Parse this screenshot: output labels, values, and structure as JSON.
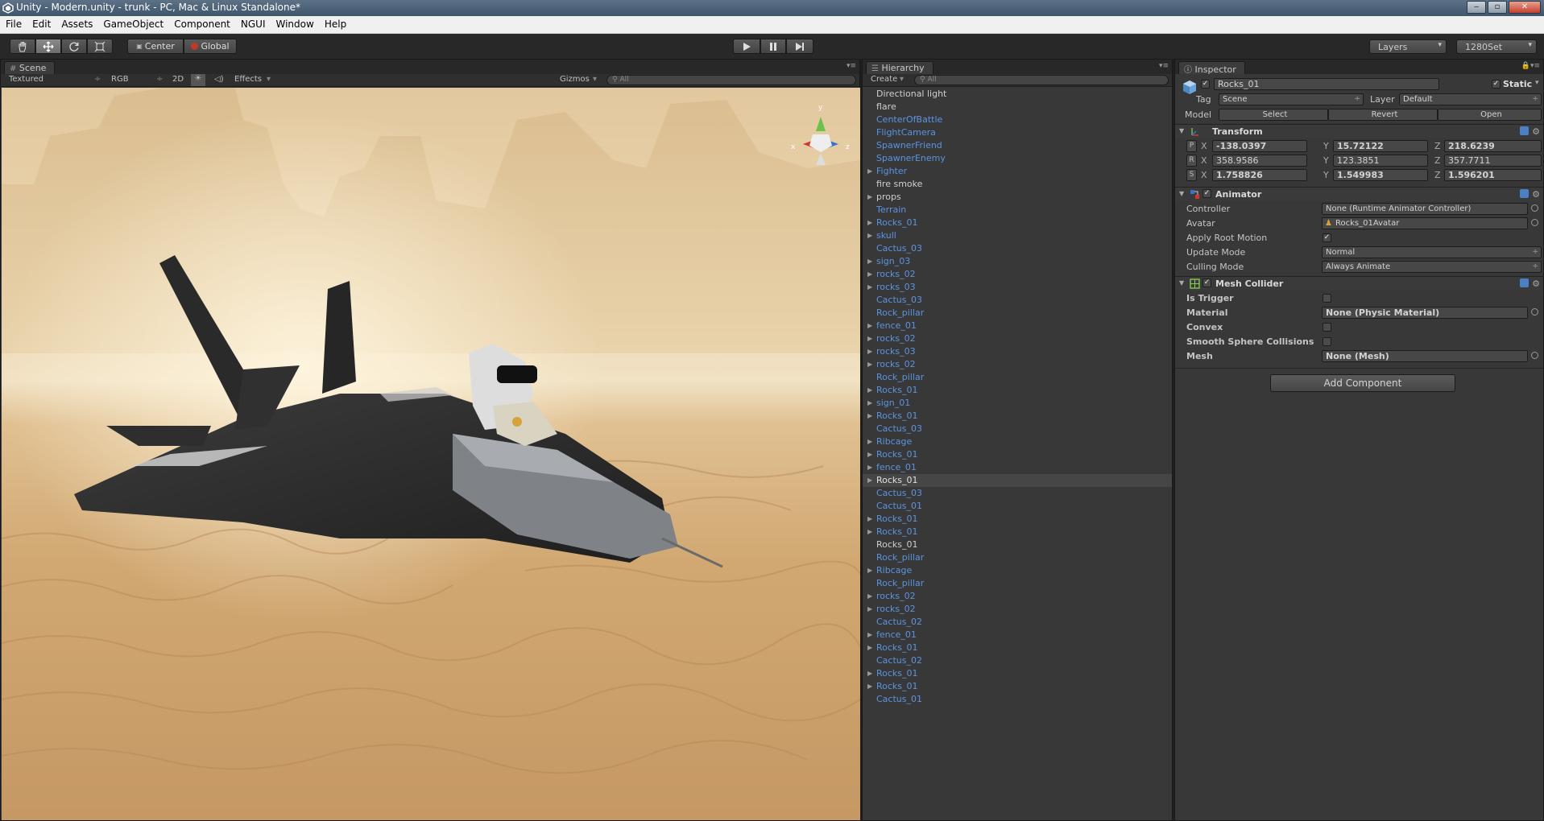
{
  "window": {
    "title": "Unity - Modern.unity - trunk - PC, Mac & Linux Standalone*"
  },
  "menu": [
    "File",
    "Edit",
    "Assets",
    "GameObject",
    "Component",
    "NGUI",
    "Window",
    "Help"
  ],
  "toolbar": {
    "pivot": "Center",
    "space": "Global",
    "layers": "Layers",
    "layout": "1280Set"
  },
  "scene": {
    "tab": "Scene",
    "shading": "Textured",
    "render": "RGB",
    "mode2d": "2D",
    "effects": "Effects",
    "gizmos": "Gizmos",
    "search_placeholder": "All",
    "gizmo_labels": {
      "y": "y",
      "x": "x",
      "z": "z"
    }
  },
  "hierarchy": {
    "tab": "Hierarchy",
    "create": "Create",
    "search_placeholder": "All",
    "items": [
      {
        "name": "Directional light",
        "arrow": false,
        "plain": true
      },
      {
        "name": "flare",
        "arrow": false,
        "plain": true
      },
      {
        "name": "CenterOfBattle",
        "arrow": false,
        "plain": false
      },
      {
        "name": "FlightCamera",
        "arrow": false,
        "plain": false
      },
      {
        "name": "SpawnerFriend",
        "arrow": false,
        "plain": false
      },
      {
        "name": "SpawnerEnemy",
        "arrow": false,
        "plain": false
      },
      {
        "name": "Fighter",
        "arrow": true,
        "plain": false
      },
      {
        "name": "fire smoke",
        "arrow": false,
        "plain": true
      },
      {
        "name": "props",
        "arrow": true,
        "plain": true
      },
      {
        "name": "Terrain",
        "arrow": false,
        "plain": false
      },
      {
        "name": "Rocks_01",
        "arrow": true,
        "plain": false
      },
      {
        "name": "skull",
        "arrow": true,
        "plain": false
      },
      {
        "name": "Cactus_03",
        "arrow": false,
        "plain": false
      },
      {
        "name": "sign_03",
        "arrow": true,
        "plain": false
      },
      {
        "name": "rocks_02",
        "arrow": true,
        "plain": false
      },
      {
        "name": "rocks_03",
        "arrow": true,
        "plain": false
      },
      {
        "name": "Cactus_03",
        "arrow": false,
        "plain": false
      },
      {
        "name": "Rock_pillar",
        "arrow": false,
        "plain": false
      },
      {
        "name": "fence_01",
        "arrow": true,
        "plain": false
      },
      {
        "name": "rocks_02",
        "arrow": true,
        "plain": false
      },
      {
        "name": "rocks_03",
        "arrow": true,
        "plain": false
      },
      {
        "name": "rocks_02",
        "arrow": true,
        "plain": false
      },
      {
        "name": "Rock_pillar",
        "arrow": false,
        "plain": false
      },
      {
        "name": "Rocks_01",
        "arrow": true,
        "plain": false
      },
      {
        "name": "sign_01",
        "arrow": true,
        "plain": false
      },
      {
        "name": "Rocks_01",
        "arrow": true,
        "plain": false
      },
      {
        "name": "Cactus_03",
        "arrow": false,
        "plain": false
      },
      {
        "name": "Ribcage",
        "arrow": true,
        "plain": false
      },
      {
        "name": "Rocks_01",
        "arrow": true,
        "plain": false
      },
      {
        "name": "fence_01",
        "arrow": true,
        "plain": false
      },
      {
        "name": "Rocks_01",
        "arrow": true,
        "plain": true,
        "selected": true
      },
      {
        "name": "Cactus_03",
        "arrow": false,
        "plain": false
      },
      {
        "name": "Cactus_01",
        "arrow": false,
        "plain": false
      },
      {
        "name": "Rocks_01",
        "arrow": true,
        "plain": false
      },
      {
        "name": "Rocks_01",
        "arrow": true,
        "plain": false
      },
      {
        "name": "Rocks_01",
        "arrow": false,
        "plain": true
      },
      {
        "name": "Rock_pillar",
        "arrow": false,
        "plain": false
      },
      {
        "name": "Ribcage",
        "arrow": true,
        "plain": false
      },
      {
        "name": "Rock_pillar",
        "arrow": false,
        "plain": false
      },
      {
        "name": "rocks_02",
        "arrow": true,
        "plain": false
      },
      {
        "name": "rocks_02",
        "arrow": true,
        "plain": false
      },
      {
        "name": "Cactus_02",
        "arrow": false,
        "plain": false
      },
      {
        "name": "fence_01",
        "arrow": true,
        "plain": false
      },
      {
        "name": "Rocks_01",
        "arrow": true,
        "plain": false
      },
      {
        "name": "Cactus_02",
        "arrow": false,
        "plain": false
      },
      {
        "name": "Rocks_01",
        "arrow": true,
        "plain": false
      },
      {
        "name": "Rocks_01",
        "arrow": true,
        "plain": false
      },
      {
        "name": "Cactus_01",
        "arrow": false,
        "plain": false
      }
    ]
  },
  "inspector": {
    "tab": "Inspector",
    "object_name": "Rocks_01",
    "static_label": "Static",
    "tag_label": "Tag",
    "tag_value": "Scene",
    "layer_label": "Layer",
    "layer_value": "Default",
    "model_label": "Model",
    "model_select": "Select",
    "model_revert": "Revert",
    "model_open": "Open",
    "transform": {
      "title": "Transform",
      "rows": [
        {
          "key": "P",
          "x": "-138.0397",
          "y": "15.72122",
          "z": "218.6239"
        },
        {
          "key": "R",
          "x": "358.9586",
          "y": "123.3851",
          "z": "357.7711"
        },
        {
          "key": "S",
          "x": "1.758826",
          "y": "1.549983",
          "z": "1.596201"
        }
      ],
      "axis_x": "X",
      "axis_y": "Y",
      "axis_z": "Z"
    },
    "animator": {
      "title": "Animator",
      "controller_label": "Controller",
      "controller_value": "None (Runtime Animator Controller)",
      "avatar_label": "Avatar",
      "avatar_value": "Rocks_01Avatar",
      "apply_root_label": "Apply Root Motion",
      "update_mode_label": "Update Mode",
      "update_mode_value": "Normal",
      "culling_mode_label": "Culling Mode",
      "culling_mode_value": "Always Animate"
    },
    "mesh_collider": {
      "title": "Mesh Collider",
      "is_trigger_label": "Is Trigger",
      "material_label": "Material",
      "material_value": "None (Physic Material)",
      "convex_label": "Convex",
      "smooth_label": "Smooth Sphere Collisions",
      "mesh_label": "Mesh",
      "mesh_value": "None (Mesh)"
    },
    "add_component": "Add Component"
  },
  "colors": {
    "hierarchy_prefab": "#5c93e0",
    "panel_bg": "#383838",
    "toolbar_bg": "#282828"
  }
}
